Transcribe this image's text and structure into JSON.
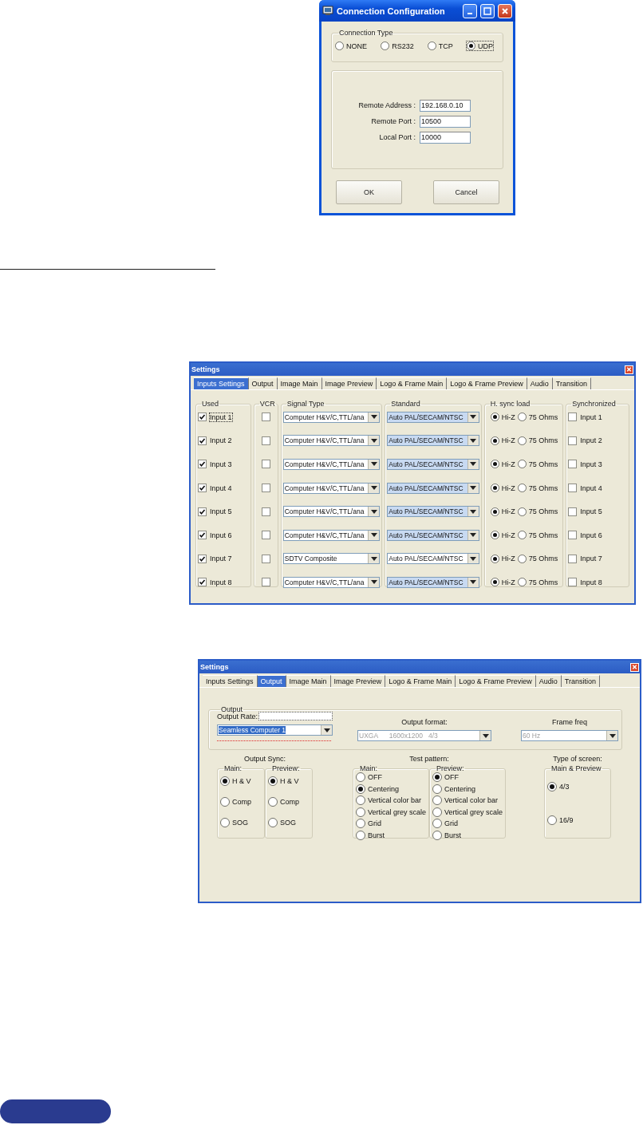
{
  "connection_dialog": {
    "title": "Connection Configuration",
    "connection_type": {
      "legend": "Connection Type",
      "options": [
        {
          "label": "NONE",
          "selected": false,
          "focused": false
        },
        {
          "label": "RS232",
          "selected": false,
          "focused": false
        },
        {
          "label": "TCP",
          "selected": false,
          "focused": false
        },
        {
          "label": "UDP",
          "selected": true,
          "focused": true
        }
      ]
    },
    "fields": [
      {
        "label": "Remote Address :",
        "value": "192.168.0.10"
      },
      {
        "label": "Remote Port :",
        "value": "10500"
      },
      {
        "label": "Local Port :",
        "value": "10000"
      }
    ],
    "buttons": [
      "OK",
      "Cancel"
    ]
  },
  "inputs_settings": {
    "title": "Settings",
    "tabs": [
      {
        "label": "Inputs Settings",
        "selected": true
      },
      {
        "label": "Output",
        "selected": false
      },
      {
        "label": "Image Main",
        "selected": false
      },
      {
        "label": "Image Preview",
        "selected": false
      },
      {
        "label": "Logo & Frame Main",
        "selected": false
      },
      {
        "label": "Logo & Frame Preview",
        "selected": false
      },
      {
        "label": "Audio",
        "selected": false
      },
      {
        "label": "Transition",
        "selected": false
      }
    ],
    "columns": [
      "Used",
      "VCR",
      "Signal Type",
      "Standard",
      "H. sync load",
      "Synchronized"
    ],
    "rows": [
      {
        "input": "Input 1",
        "used": true,
        "focused": true,
        "vcr": false,
        "signal_type": "Computer H&V/C,TTL/ana",
        "standard": "Auto PAL/SECAM/NTSC",
        "standard_highlighted": true,
        "hsync": [
          {
            "label": "Hi-Z",
            "selected": true
          },
          {
            "label": "75 Ohms",
            "selected": false
          }
        ],
        "sync_label": "Input 1",
        "synchronized": false
      },
      {
        "input": "Input 2",
        "used": true,
        "focused": false,
        "vcr": false,
        "signal_type": "Computer H&V/C,TTL/ana",
        "standard": "Auto PAL/SECAM/NTSC",
        "standard_highlighted": true,
        "hsync": [
          {
            "label": "Hi-Z",
            "selected": true
          },
          {
            "label": "75 Ohms",
            "selected": false
          }
        ],
        "sync_label": "Input 2",
        "synchronized": false
      },
      {
        "input": "Input 3",
        "used": true,
        "focused": false,
        "vcr": false,
        "signal_type": "Computer H&V/C,TTL/ana",
        "standard": "Auto PAL/SECAM/NTSC",
        "standard_highlighted": true,
        "hsync": [
          {
            "label": "Hi-Z",
            "selected": true
          },
          {
            "label": "75 Ohms",
            "selected": false
          }
        ],
        "sync_label": "Input 3",
        "synchronized": false
      },
      {
        "input": "Input 4",
        "used": true,
        "focused": false,
        "vcr": false,
        "signal_type": "Computer H&V/C,TTL/ana",
        "standard": "Auto PAL/SECAM/NTSC",
        "standard_highlighted": true,
        "hsync": [
          {
            "label": "Hi-Z",
            "selected": true
          },
          {
            "label": "75 Ohms",
            "selected": false
          }
        ],
        "sync_label": "Input 4",
        "synchronized": false
      },
      {
        "input": "Input 5",
        "used": true,
        "focused": false,
        "vcr": false,
        "signal_type": "Computer H&V/C,TTL/ana",
        "standard": "Auto PAL/SECAM/NTSC",
        "standard_highlighted": true,
        "hsync": [
          {
            "label": "Hi-Z",
            "selected": true
          },
          {
            "label": "75 Ohms",
            "selected": false
          }
        ],
        "sync_label": "Input 5",
        "synchronized": false
      },
      {
        "input": "Input 6",
        "used": true,
        "focused": false,
        "vcr": false,
        "signal_type": "Computer H&V/C,TTL/ana",
        "standard": "Auto PAL/SECAM/NTSC",
        "standard_highlighted": true,
        "hsync": [
          {
            "label": "Hi-Z",
            "selected": true
          },
          {
            "label": "75 Ohms",
            "selected": false
          }
        ],
        "sync_label": "Input 6",
        "synchronized": false
      },
      {
        "input": "Input 7",
        "used": true,
        "focused": false,
        "vcr": false,
        "signal_type": "SDTV Composite",
        "standard": "Auto PAL/SECAM/NTSC",
        "standard_highlighted": false,
        "hsync": [
          {
            "label": "Hi-Z",
            "selected": true
          },
          {
            "label": "75 Ohms",
            "selected": false
          }
        ],
        "sync_label": "Input 7",
        "synchronized": false
      },
      {
        "input": "Input 8",
        "used": true,
        "focused": false,
        "vcr": false,
        "signal_type": "Computer H&V/C,TTL/ana",
        "standard": "Auto PAL/SECAM/NTSC",
        "standard_highlighted": true,
        "hsync": [
          {
            "label": "Hi-Z",
            "selected": true
          },
          {
            "label": "75 Ohms",
            "selected": false
          }
        ],
        "sync_label": "Input 8",
        "synchronized": false
      }
    ]
  },
  "output_settings": {
    "title": "Settings",
    "tabs": [
      {
        "label": "Inputs Settings",
        "selected": false
      },
      {
        "label": "Output",
        "selected": true
      },
      {
        "label": "Image Main",
        "selected": false
      },
      {
        "label": "Image Preview",
        "selected": false
      },
      {
        "label": "Logo & Frame Main",
        "selected": false
      },
      {
        "label": "Logo & Frame Preview",
        "selected": false
      },
      {
        "label": "Audio",
        "selected": false
      },
      {
        "label": "Transition",
        "selected": false
      }
    ],
    "output": {
      "legend": "Output",
      "output_rate_label": "Output Rate:",
      "output_rate": {
        "value": "Seamless Computer 1",
        "highlighted": true,
        "disabled": false
      },
      "output_format_label": "Output format:",
      "output_format": {
        "value": "UXGA      1600x1200   4/3",
        "highlighted": false,
        "disabled": true
      },
      "frame_freq_label": "Frame freq",
      "frame_freq": {
        "value": "60 Hz",
        "highlighted": false,
        "disabled": true
      }
    },
    "sections": [
      {
        "title": "Output Sync:",
        "kind": "sync",
        "groups": [
          {
            "legend": "Main:",
            "options": [
              {
                "label": "H & V",
                "selected": true
              },
              {
                "label": "Comp",
                "selected": false
              },
              {
                "label": "SOG",
                "selected": false
              }
            ]
          },
          {
            "legend": "Preview:",
            "options": [
              {
                "label": "H & V",
                "selected": true
              },
              {
                "label": "Comp",
                "selected": false
              },
              {
                "label": "SOG",
                "selected": false
              }
            ]
          }
        ]
      },
      {
        "title": "Test pattern:",
        "kind": "pattern",
        "groups": [
          {
            "legend": "Main:",
            "options": [
              {
                "label": "OFF",
                "selected": false
              },
              {
                "label": "Centering",
                "selected": true
              },
              {
                "label": "Vertical color bar",
                "selected": false
              },
              {
                "label": "Vertical grey scale",
                "selected": false
              },
              {
                "label": "Grid",
                "selected": false
              },
              {
                "label": "Burst",
                "selected": false
              }
            ]
          },
          {
            "legend": "Preview:",
            "options": [
              {
                "label": "OFF",
                "selected": true
              },
              {
                "label": "Centering",
                "selected": false
              },
              {
                "label": "Vertical color bar",
                "selected": false
              },
              {
                "label": "Vertical grey scale",
                "selected": false
              },
              {
                "label": "Grid",
                "selected": false
              },
              {
                "label": "Burst",
                "selected": false
              }
            ]
          }
        ]
      },
      {
        "title": "Type of screen:",
        "kind": "screen",
        "groups": [
          {
            "legend": "Main & Preview",
            "options": [
              {
                "label": "4/3",
                "selected": true
              },
              {
                "label": "16/9",
                "selected": false
              }
            ]
          }
        ]
      }
    ]
  }
}
